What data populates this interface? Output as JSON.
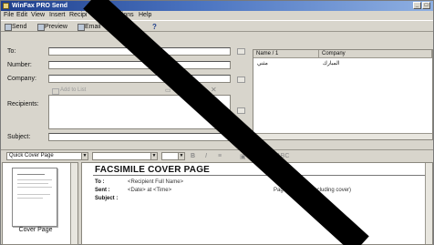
{
  "titlebar": {
    "title": "WinFax PRO Send"
  },
  "window_controls": [
    "_",
    "□"
  ],
  "menu": [
    "File",
    "Edit",
    "View",
    "Insert",
    "Recipi",
    "ptions",
    "Help"
  ],
  "toolbar": {
    "send": "Send",
    "preview": "Preview",
    "email": "Email",
    "help_icon": "question-arrow-icon"
  },
  "fields": {
    "to": "To:",
    "number": "Number:",
    "company": "Company:",
    "recipients": "Recipients:",
    "subject": "Subject:"
  },
  "recipient_toolbar": {
    "add": "Add to List"
  },
  "recipient_list": {
    "columns": [
      "Name / 1",
      "Company"
    ],
    "rows": [
      {
        "name": "مثني",
        "company": "المبارك"
      }
    ]
  },
  "format_bar": {
    "cover_combo": "Quick Cover Page"
  },
  "thumbnail": {
    "label": "Cover Page"
  },
  "cover": {
    "title": "FACSIMILE COVER PAGE",
    "to_label": "To :",
    "to_value": "<Recipient Full Name>",
    "sent_label": "Sent :",
    "sent_value": "<Date> at <Time>",
    "subject_label": "Subject :",
    "pages_text": "Pag",
    "pages_suffix": "d (including cover)"
  },
  "colors": {
    "titlebar": "#1f3f8c",
    "chrome": "#d8d5cc",
    "strike": "#000000"
  }
}
